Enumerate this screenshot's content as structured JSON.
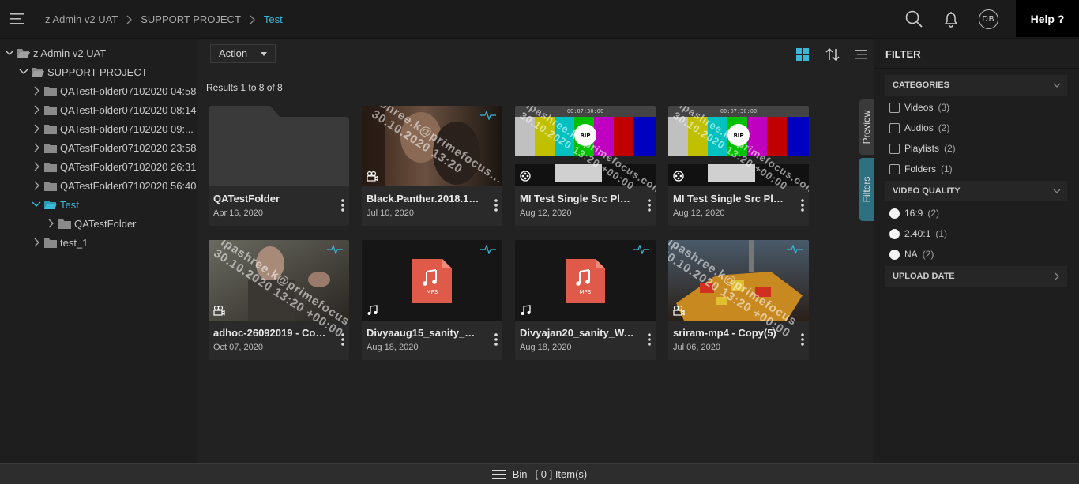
{
  "breadcrumb": {
    "items": [
      "z Admin v2 UAT",
      "SUPPORT PROJECT",
      "Test"
    ]
  },
  "header": {
    "user_initials": "DB",
    "help_label": "Help ?"
  },
  "tree": {
    "items": [
      {
        "label": "z Admin v2 UAT"
      },
      {
        "label": "SUPPORT PROJECT"
      },
      {
        "label": "QATestFolder07102020 04:58"
      },
      {
        "label": "QATestFolder07102020 08:14"
      },
      {
        "label": "QATestFolder07102020 09:..."
      },
      {
        "label": "QATestFolder07102020 23:58"
      },
      {
        "label": "QATestFolder07102020 26:31"
      },
      {
        "label": "QATestFolder07102020 56:40"
      },
      {
        "label": "Test"
      },
      {
        "label": "QATestFolder"
      },
      {
        "label": "test_1"
      }
    ]
  },
  "toolbar": {
    "action_label": "Action",
    "results_text": "Results 1 to 8 of 8"
  },
  "assets": [
    {
      "title": "QATestFolder",
      "date": "Apr 16, 2020",
      "type": "folder"
    },
    {
      "title": "Black.Panther.2018.108...",
      "date": "Jul 10, 2020",
      "type": "video",
      "watermark": "Shree.k@primefocus...\n30.10.2020 13:20"
    },
    {
      "title": "MI Test Single Src Playli...",
      "date": "Aug 12, 2020",
      "type": "playlist",
      "watermark": "ipashree.k@primefocus.com\n30.10.2020 13:20 +00:00",
      "slate": "BIP",
      "timecode": "00:07:30:00"
    },
    {
      "title": "MI Test Single Src Playli...",
      "date": "Aug 12, 2020",
      "type": "playlist",
      "watermark": "ipashree.k@primefocus.com\n30.10.2020 13:20 +00:00",
      "slate": "BIP",
      "timecode": "00:07:30:00"
    },
    {
      "title": "adhoc-26092019 - Copy(...",
      "date": "Oct 07, 2020",
      "type": "video",
      "watermark": "ipashree.k@primefocus\n30.10.2020 13:20 +00:00"
    },
    {
      "title": "Divyaaug15_sanity_WAV...",
      "date": "Aug 18, 2020",
      "type": "audio",
      "badge": "MP3"
    },
    {
      "title": "Divyajan20_sanity_WAVs...",
      "date": "Aug 18, 2020",
      "type": "audio",
      "badge": "MP3"
    },
    {
      "title": "sriram-mp4 - Copy(5)",
      "date": "Jul 06, 2020",
      "type": "video",
      "watermark": "ipashree.k@primefocus\n30.10.2020 13:20 +00:00"
    }
  ],
  "side_tabs": {
    "preview": "Preview",
    "filters": "Filters"
  },
  "filter": {
    "title": "FILTER",
    "categories": {
      "label": "CATEGORIES",
      "options": [
        {
          "label": "Videos",
          "count": "(3)"
        },
        {
          "label": "Audios",
          "count": "(2)"
        },
        {
          "label": "Playlists",
          "count": "(2)"
        },
        {
          "label": "Folders",
          "count": "(1)"
        }
      ]
    },
    "video_quality": {
      "label": "VIDEO QUALITY",
      "options": [
        {
          "label": "16:9",
          "count": "(2)"
        },
        {
          "label": "2.40:1",
          "count": "(1)"
        },
        {
          "label": "NA",
          "count": "(2)"
        }
      ]
    },
    "upload_date": {
      "label": "UPLOAD DATE"
    }
  },
  "bin": {
    "label": "Bin",
    "count_text": "[ 0 ] Item(s)"
  },
  "colors": {
    "accent": "#3bb8d8",
    "folder": "#8a8a8a",
    "mp3": "#e05a4a"
  }
}
